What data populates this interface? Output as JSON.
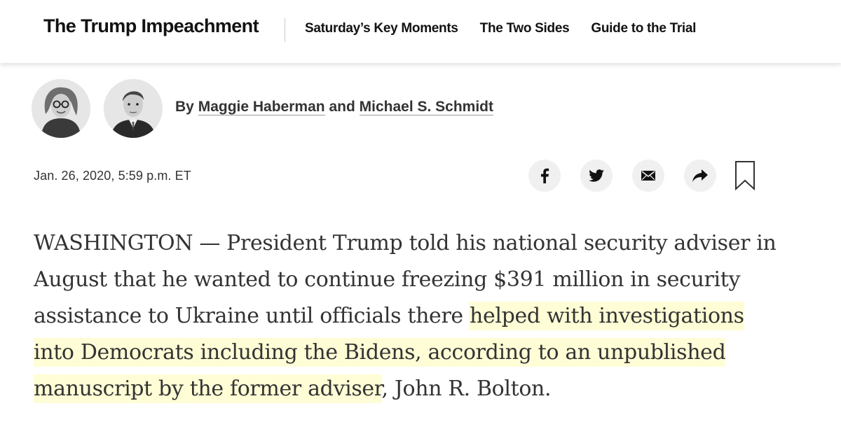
{
  "header": {
    "brand": "The Trump Impeachment",
    "nav": [
      {
        "label": "Saturday’s Key Moments"
      },
      {
        "label": "The Two Sides"
      },
      {
        "label": "Guide to the Trial"
      }
    ]
  },
  "byline": {
    "prefix": "By",
    "author1": "Maggie Haberman",
    "joiner": "and",
    "author2": "Michael S. Schmidt"
  },
  "timestamp": "Jan. 26, 2020, 5:59 p.m. ET",
  "share": {
    "icons": [
      "facebook-icon",
      "twitter-icon",
      "email-icon",
      "share-arrow-icon",
      "bookmark-icon"
    ]
  },
  "article": {
    "lines": [
      "WASHINGTON — President Trump told his national security",
      "adviser in August that he wanted to continue freezing $391 million",
      "in security assistance to Ukraine until officials there "
    ],
    "plain_1": "WASHINGTON — President Trump told his national security adviser in August that he wanted to continue freezing $391 million in security assistance to Ukraine until officials there ",
    "highlight": "helped with investigations into Democrats including the Bidens, according to an unpublished manuscript by the former adviser",
    "plain_2": ", John R. Bolton."
  },
  "colors": {
    "highlight": "#fffdd6",
    "text": "#333333",
    "share_bg": "#f0f0f0"
  }
}
